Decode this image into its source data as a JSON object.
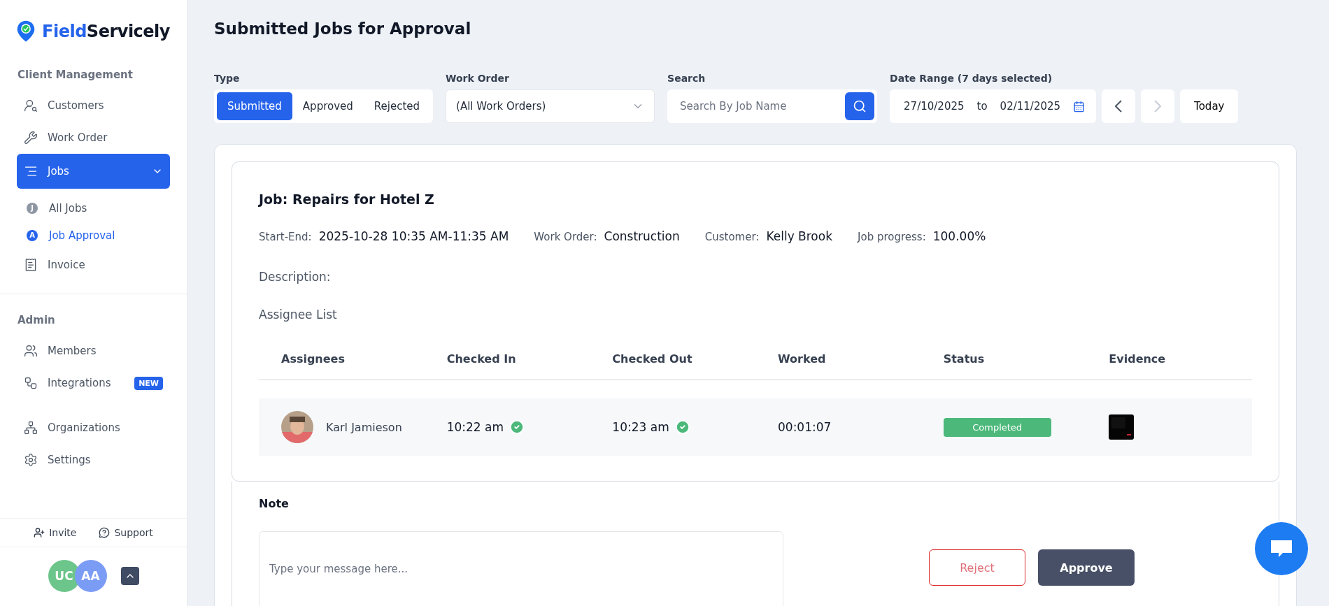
{
  "brand": {
    "first": "Field",
    "second": "Servicely"
  },
  "sidebar": {
    "sections": [
      {
        "title": "Client Management",
        "items": [
          {
            "label": "Customers",
            "selected": false
          },
          {
            "label": "Work Order",
            "selected": false
          },
          {
            "label": "Jobs",
            "selected": true,
            "expanded": true,
            "children": [
              {
                "label": "All Jobs",
                "letter": "J",
                "selected": false
              },
              {
                "label": "Job Approval",
                "letter": "A",
                "selected": true
              }
            ]
          },
          {
            "label": "Invoice",
            "selected": false
          }
        ]
      },
      {
        "title": "Admin",
        "items": [
          {
            "label": "Members",
            "selected": false
          },
          {
            "label": "Integrations",
            "selected": false,
            "badge": "NEW"
          },
          {
            "label": "Organizations",
            "selected": false
          },
          {
            "label": "Settings",
            "selected": false
          }
        ]
      }
    ],
    "footer_links": [
      "Invite",
      "Support"
    ],
    "avatars": [
      {
        "initials": "UC",
        "color": "#6cc58a"
      },
      {
        "initials": "AA",
        "color": "#7b9cf5"
      }
    ]
  },
  "page_title": "Submitted Jobs for Approval",
  "filters": {
    "type": {
      "label": "Type",
      "options": [
        {
          "label": "Submitted",
          "selected": true
        },
        {
          "label": "Approved",
          "selected": false
        },
        {
          "label": "Rejected",
          "selected": false
        }
      ]
    },
    "work_order": {
      "label": "Work Order",
      "value": "(All Work Orders)"
    },
    "search": {
      "label": "Search",
      "placeholder": "Search By Job Name"
    },
    "date_range": {
      "label": "Date Range (7 days selected)",
      "start": "27/10/2025",
      "to": "to",
      "end": "02/11/2025",
      "prev_disabled": false,
      "next_disabled": true,
      "today": "Today"
    }
  },
  "job": {
    "title": "Job: Repairs for Hotel Z",
    "meta": [
      {
        "label": "Start-End:",
        "value": "2025-10-28 10:35 AM-11:35 AM"
      },
      {
        "label": "Work Order:",
        "value": "Construction"
      },
      {
        "label": "Customer:",
        "value": "Kelly Brook"
      },
      {
        "label": "Job progress:",
        "value": "100.00%"
      }
    ],
    "description_label": "Description:",
    "assignee_heading": "Assignee List",
    "columns": [
      "Assignees",
      "Checked In",
      "Checked Out",
      "Worked",
      "Status",
      "Evidence"
    ],
    "rows": [
      {
        "name": "Karl Jamieson",
        "checked_in": "10:22 am",
        "checked_out": "10:23 am",
        "worked": "00:01:07",
        "status": "Completed"
      }
    ]
  },
  "note": {
    "label": "Note",
    "placeholder": "Type your message here...",
    "reject": "Reject",
    "approve": "Approve"
  }
}
